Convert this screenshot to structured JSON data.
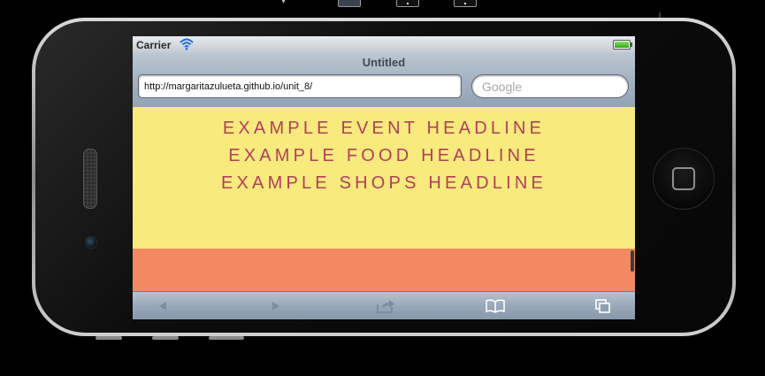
{
  "device": {
    "status_bar": {
      "carrier": "Carrier"
    },
    "browser": {
      "page_title": "Untitled",
      "url": "http://margaritazulueta.github.io/unit_8/",
      "search_placeholder": "Google"
    }
  },
  "page": {
    "headlines": [
      "EXAMPLE EVENT HEADLINE",
      "EXAMPLE FOOD HEADLINE",
      "EXAMPLE SHOPS HEADLINE"
    ]
  },
  "icons": {
    "toolbar": [
      "back-arrow-icon",
      "forward-arrow-icon",
      "share-icon",
      "bookmarks-icon",
      "pages-icon"
    ],
    "status": [
      "wifi-icon",
      "battery-icon"
    ],
    "hardware": [
      "home-button-icon"
    ]
  },
  "colors": {
    "content_background": "#f9ea7e",
    "headline_text": "#b43f58",
    "orange_band": "#f38862"
  }
}
